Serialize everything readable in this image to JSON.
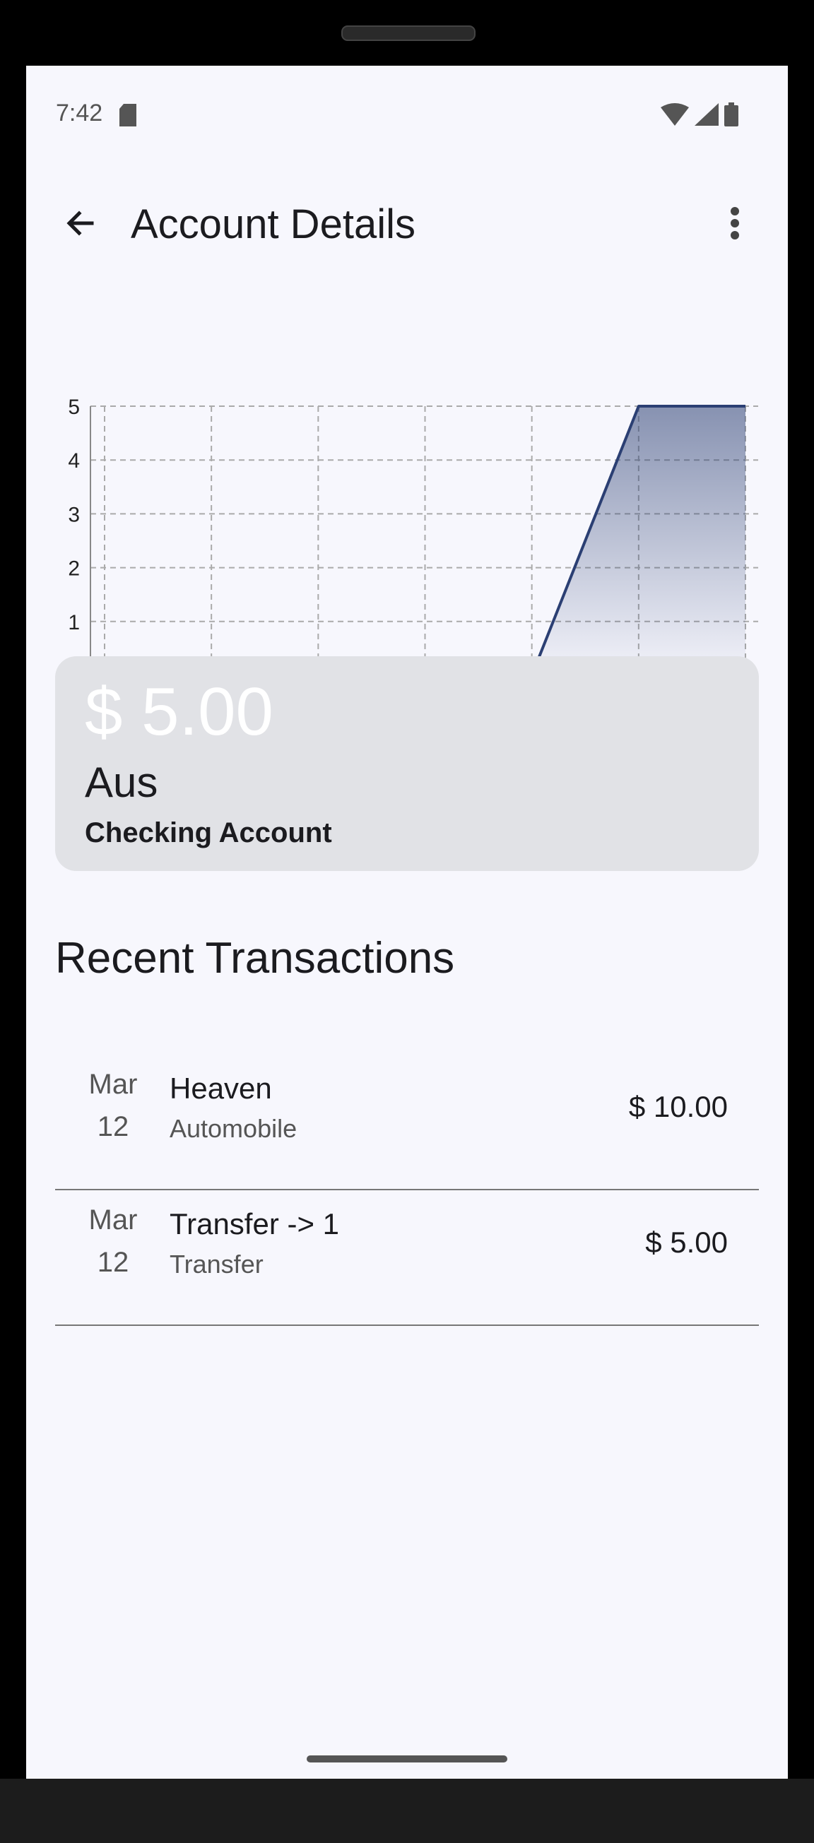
{
  "status_bar": {
    "time": "7:42"
  },
  "app_bar": {
    "title": "Account Details"
  },
  "colors": {
    "accent": "#2b3f73",
    "card_bg": "#e1e2e6",
    "screen_bg": "#f7f7fd"
  },
  "icons": {
    "back": "arrow-left-icon",
    "menu": "more-vert-icon",
    "sd": "sd-card-icon",
    "wifi": "wifi-icon",
    "signal": "signal-icon",
    "battery": "battery-icon"
  },
  "chart_data": {
    "type": "area",
    "x": [
      0,
      1,
      2,
      3,
      4,
      5,
      6
    ],
    "series": [
      {
        "values": [
          0,
          0,
          0,
          0,
          0,
          5,
          5
        ]
      }
    ],
    "xlim": [
      0,
      6
    ],
    "ylim": [
      0,
      5
    ],
    "x_ticks": [
      "0",
      "1",
      "2",
      "3",
      "4",
      "5",
      "6"
    ],
    "y_ticks": [
      "0",
      "1",
      "2",
      "3",
      "4",
      "5"
    ],
    "grid": true,
    "title": "",
    "xlabel": "",
    "ylabel": ""
  },
  "account_card": {
    "balance": "$ 5.00",
    "name": "Aus",
    "type": "Checking Account"
  },
  "recent": {
    "title": "Recent Transactions",
    "transactions": [
      {
        "month": "Mar",
        "day": "12",
        "payee": "Heaven",
        "category": "Automobile",
        "amount": "$ 10.00"
      },
      {
        "month": "Mar",
        "day": "12",
        "payee": "Transfer -> 1",
        "category": "Transfer",
        "amount": "$ 5.00"
      }
    ]
  }
}
